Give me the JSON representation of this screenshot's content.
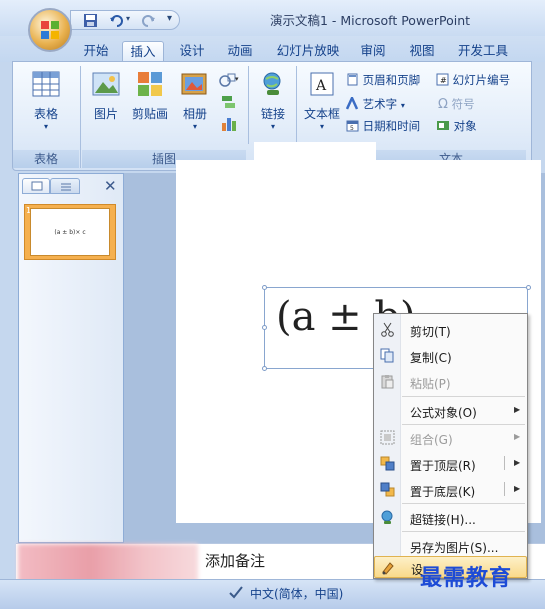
{
  "window": {
    "title": "演示文稿1 - Microsoft PowerPoint"
  },
  "tabs": [
    {
      "label": "开始"
    },
    {
      "label": "插入"
    },
    {
      "label": "设计"
    },
    {
      "label": "动画"
    },
    {
      "label": "幻灯片放映"
    },
    {
      "label": "审阅"
    },
    {
      "label": "视图"
    },
    {
      "label": "开发工具"
    }
  ],
  "ribbon": {
    "groups": {
      "table": "表格",
      "illustrations": "插图",
      "text": "文本"
    },
    "buttons": {
      "table": "表格",
      "picture": "图片",
      "clipart": "剪贴画",
      "album": "相册",
      "link": "链接",
      "textbox": "文本框",
      "header_footer": "页眉和页脚",
      "wordart": "艺术字",
      "datetime": "日期和时间",
      "slide_number": "幻灯片编号",
      "symbol": "符号",
      "object": "对象"
    }
  },
  "slide": {
    "thumb_number": "1",
    "thumb_text": "(a ± b)× c",
    "formula_text": "(a  ±  b)"
  },
  "notes": {
    "placeholder": "添加备注"
  },
  "statusbar": {
    "language": "中文(简体，中国)"
  },
  "context_menu": {
    "items": [
      {
        "label": "剪切(T)",
        "enabled": true
      },
      {
        "label": "复制(C)",
        "enabled": true
      },
      {
        "label": "粘贴(P)",
        "enabled": false
      },
      {
        "label": "公式对象(O)",
        "enabled": true
      },
      {
        "label": "组合(G)",
        "enabled": false
      },
      {
        "label": "置于顶层(R)",
        "enabled": true
      },
      {
        "label": "置于底层(K)",
        "enabled": true
      },
      {
        "label": "超链接(H)...",
        "enabled": true
      },
      {
        "label": "另存为图片(S)...",
        "enabled": true
      },
      {
        "label": "设",
        "enabled": true
      }
    ]
  },
  "watermark": "最需教育"
}
